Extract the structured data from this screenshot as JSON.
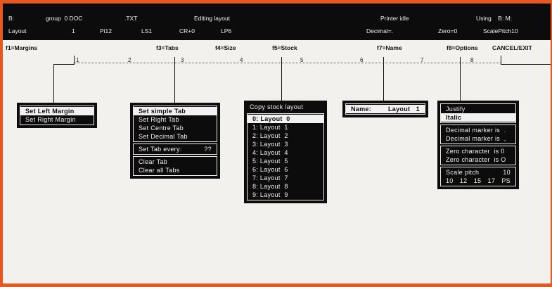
{
  "status": {
    "drive": "B:",
    "group": "group  0 DOC",
    "ext": ".TXT",
    "mode": "Editing layout",
    "printer": "Printer idle",
    "using": "Using    B: M:",
    "layout_label": "Layout",
    "layout_num": "1",
    "pitch": "Pi12",
    "ls": "LS1",
    "cr": "CR+0",
    "lp": "LP6",
    "decimal": "Decimal=.",
    "zero": "Zero=0",
    "scale": "ScalePitch10"
  },
  "fkeys": {
    "f1": "f1=Margins",
    "f3": "f3=Tabs",
    "f4": "f4=Size",
    "f5": "f5=Stock",
    "f7": "f7=Name",
    "f8": "f8=Options",
    "cancel": "CANCEL/EXIT"
  },
  "ruler": {
    "marks": [
      "1",
      "2",
      "3",
      "4",
      "5",
      "6",
      "7",
      "8"
    ]
  },
  "margins_menu": {
    "items": [
      "Set Left Margin",
      "Set Right Margin"
    ]
  },
  "tabs_menu": {
    "set_items": [
      "Set simple Tab",
      "Set Right Tab",
      "Set Centre Tab",
      "Set Decimal Tab"
    ],
    "every_label": "Set Tab every:",
    "every_value": "??",
    "clear_items": [
      "Clear Tab",
      "Clear all Tabs"
    ]
  },
  "stock_menu": {
    "title": "Copy stock layout",
    "layouts": [
      "0: Layout  0",
      "1: Layout  1",
      "2: Layout  2",
      "3: Layout  3",
      "4: Layout  4",
      "5: Layout  5",
      "6: Layout  6",
      "7: Layout  7",
      "8: Layout  8",
      "9: Layout  9"
    ]
  },
  "name_menu": {
    "label": "Name:",
    "value": "Layout   1"
  },
  "options_menu": {
    "style_items": [
      "Justify",
      "Italic"
    ],
    "decimal_items": [
      "Decimal marker is  .",
      "Decimal marker is  ,"
    ],
    "zero_items": [
      "Zero character  is 0",
      "Zero character  is O"
    ],
    "scale_label": "Scale pitch",
    "scale_value": "10",
    "pitches": [
      "10",
      "12",
      "15",
      "17",
      "PS"
    ]
  },
  "colors": {
    "frame": "#e8571d",
    "screen": "#f3f1ee",
    "ink": "#0c0c0c"
  }
}
